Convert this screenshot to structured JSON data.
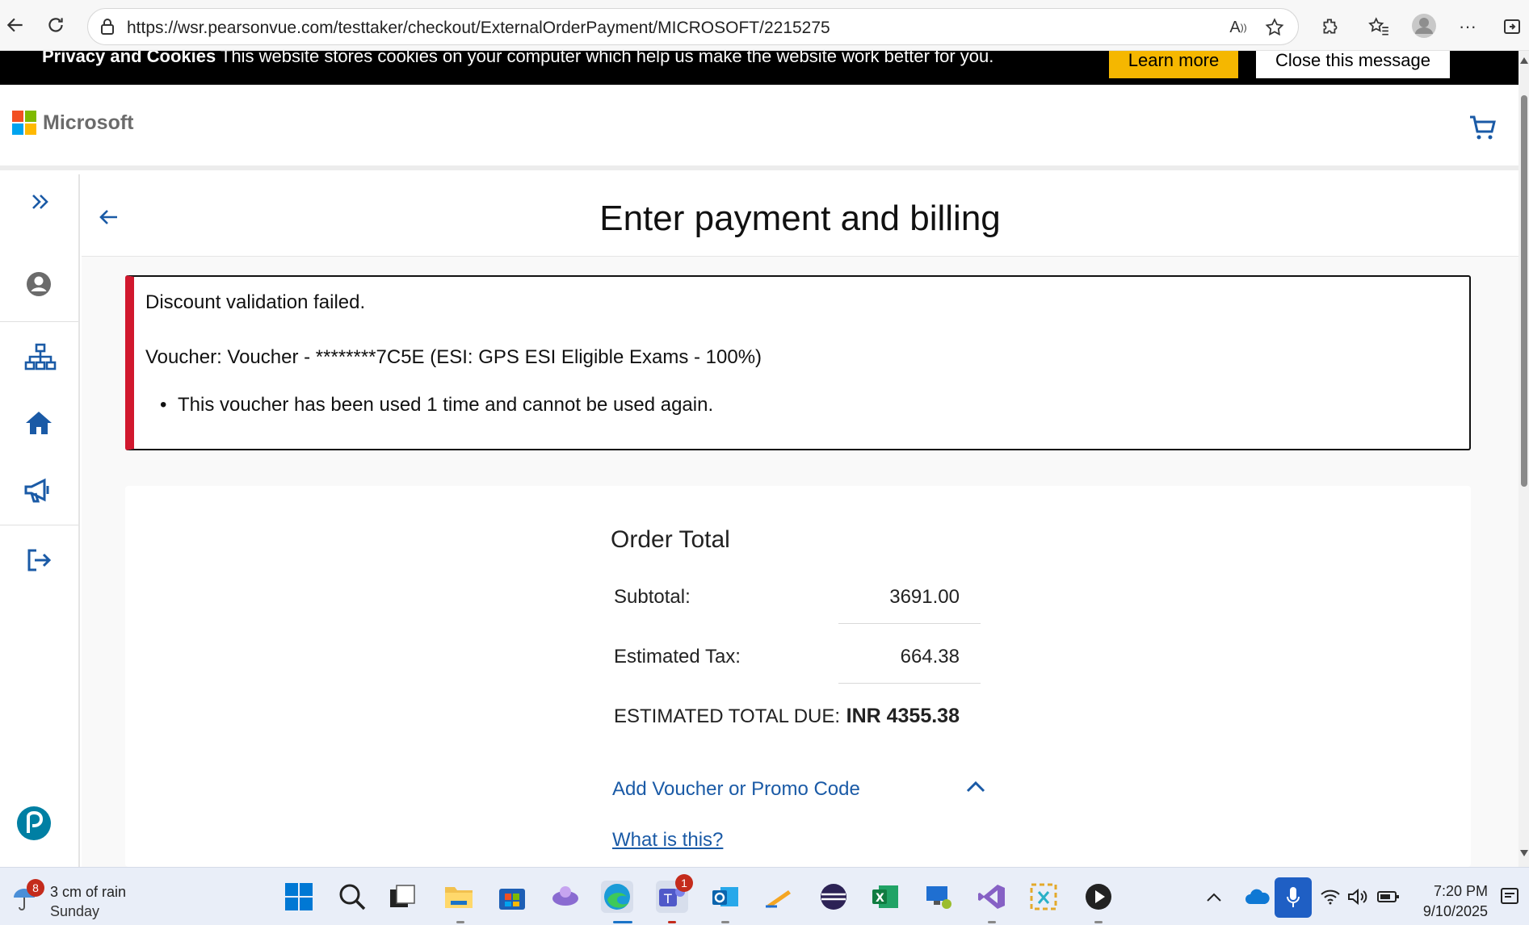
{
  "browser": {
    "url": "https://wsr.pearsonvue.com/testtaker/checkout/ExternalOrderPayment/MICROSOFT/2215275"
  },
  "cookie_banner": {
    "heading": "Privacy and Cookies",
    "text": " This website stores cookies on your computer which help us make the website work better for you.",
    "learn_more": "Learn more",
    "close": "Close this message"
  },
  "header": {
    "brand": "Microsoft"
  },
  "page": {
    "title": "Enter payment and billing"
  },
  "alert": {
    "title": "Discount validation failed.",
    "voucher": "Voucher: Voucher - ********7C5E (ESI: GPS ESI Eligible Exams - 100%)",
    "bullet": "This voucher has been used 1 time and cannot be used again.",
    "accent_color": "#d1182e"
  },
  "order": {
    "title": "Order Total",
    "subtotal_label": "Subtotal:",
    "subtotal_value": "3691.00",
    "tax_label": "Estimated Tax:",
    "tax_value": "664.38",
    "total_label": "ESTIMATED TOTAL DUE:",
    "total_value": "INR 4355.38",
    "voucher_link": "Add Voucher or Promo Code",
    "what_link": "What is this?"
  },
  "taskbar": {
    "weather_temp": "3 cm of rain",
    "weather_day": "Sunday",
    "weather_badge": "8",
    "teams_badge": "1",
    "time": "7:20 PM",
    "date": "9/10/2025"
  },
  "colors": {
    "link": "#1a5aa6",
    "icon_blue": "#1a5aa6",
    "learn_more_bg": "#f5b700"
  }
}
